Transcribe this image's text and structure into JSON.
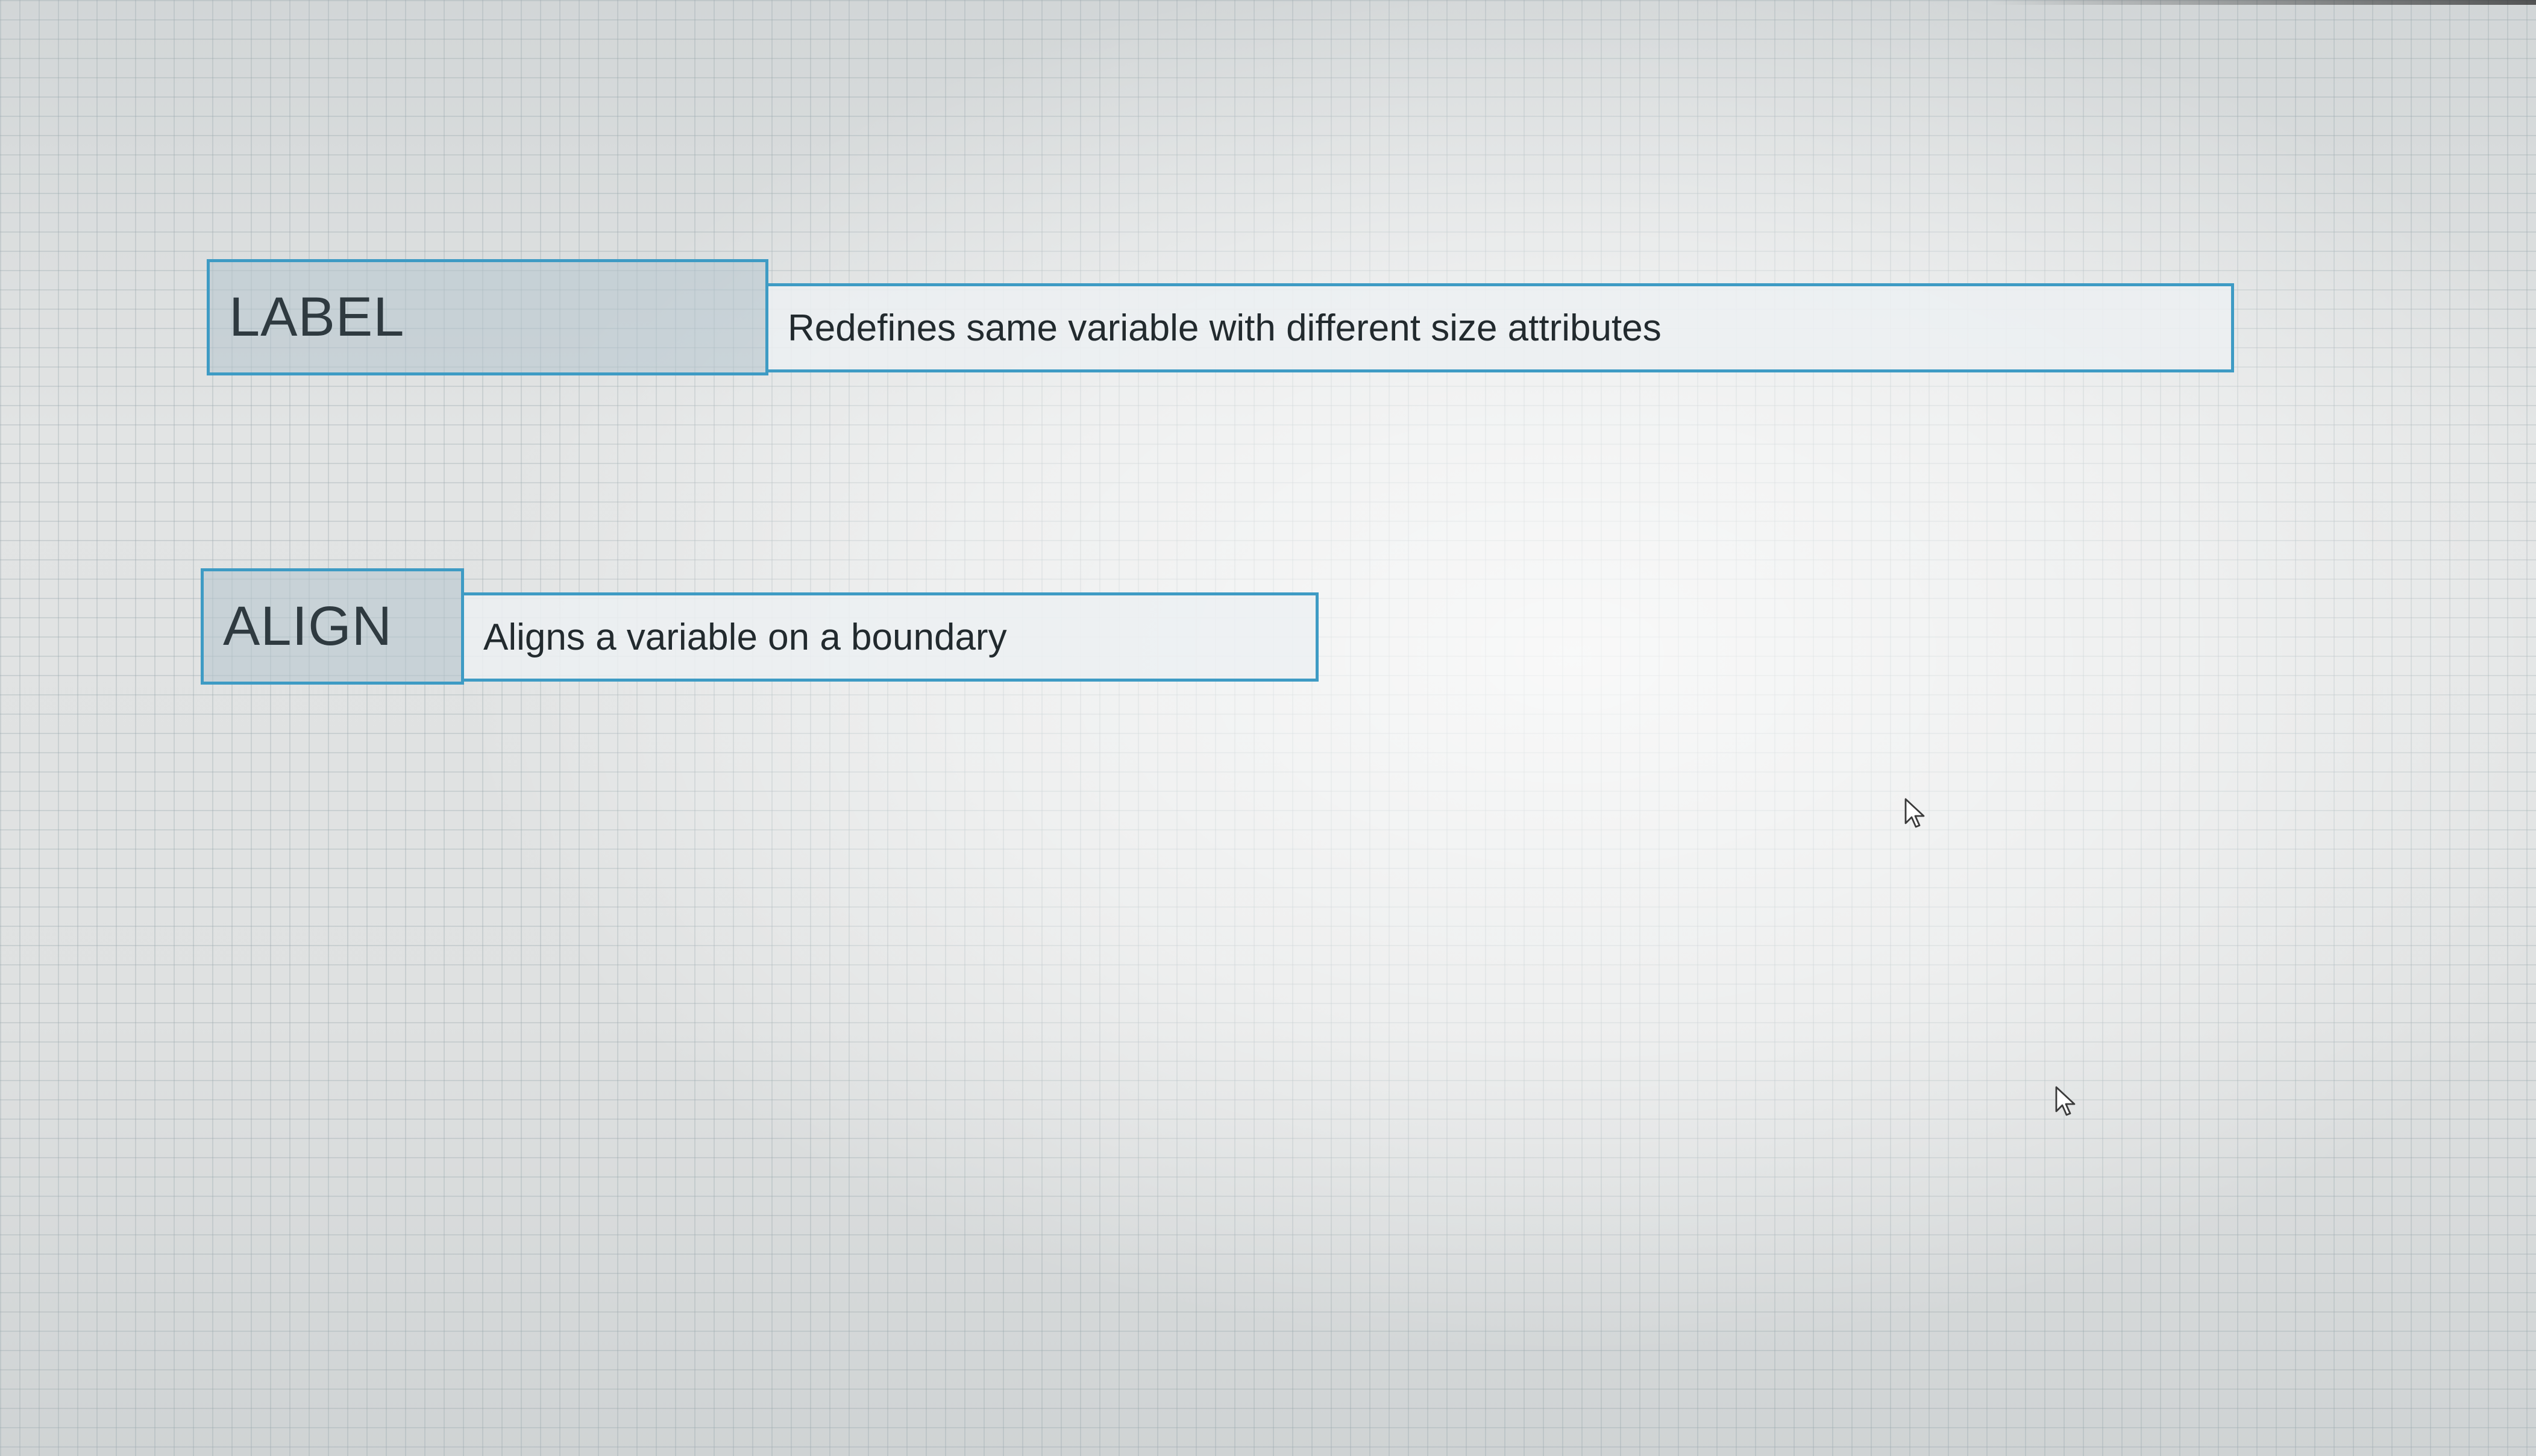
{
  "glossary": {
    "terms": [
      {
        "key": "LABEL",
        "definition": "Redefines same variable with different size attributes"
      },
      {
        "key": "ALIGN",
        "definition": "Aligns a variable on a boundary"
      }
    ]
  },
  "colors": {
    "border_accent": "#3e9bc4",
    "key_fill": "#b4c4ce",
    "background_grid": "#dadddd"
  },
  "icons": [
    "mouse-pointer-icon",
    "mouse-pointer-icon"
  ]
}
